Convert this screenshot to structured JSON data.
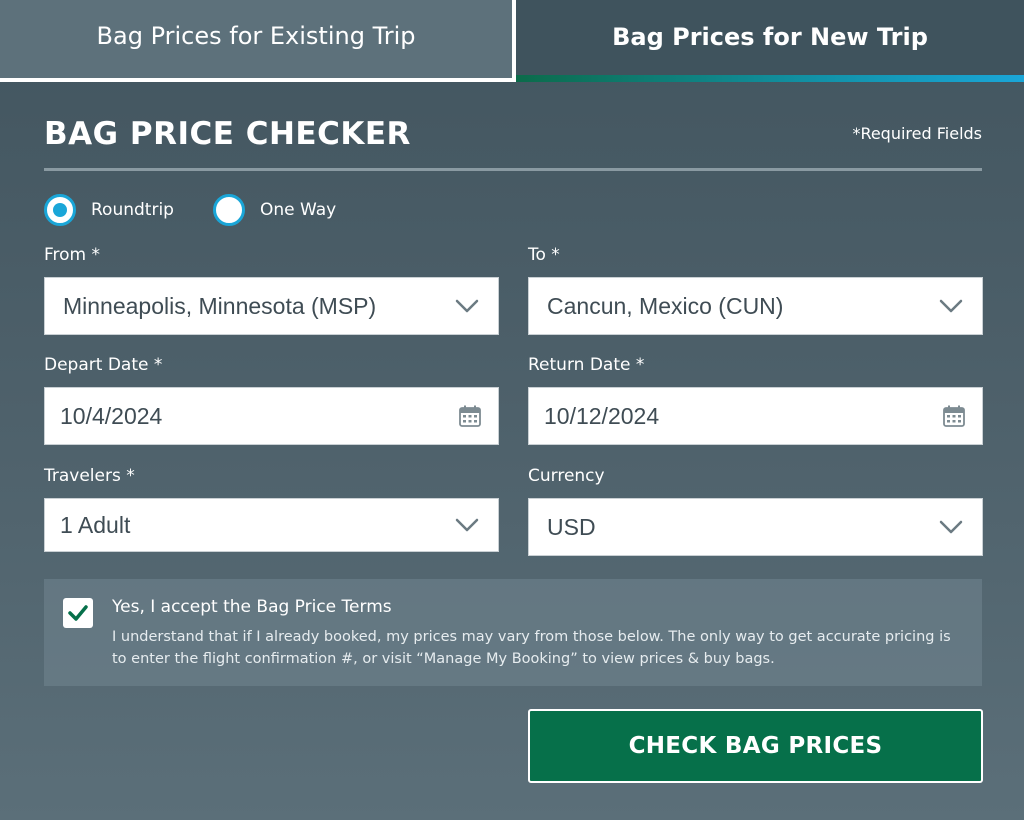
{
  "tabs": {
    "existing": "Bag Prices for Existing Trip",
    "new": "Bag Prices for New Trip",
    "active": "new"
  },
  "header": {
    "title": "BAG PRICE CHECKER",
    "required_note": "*Required Fields"
  },
  "trip_type": {
    "roundtrip": {
      "label": "Roundtrip",
      "selected": true
    },
    "one_way": {
      "label": "One Way",
      "selected": false
    }
  },
  "from": {
    "label": "From *",
    "value": "Minneapolis, Minnesota (MSP)"
  },
  "to": {
    "label": "To *",
    "value": "Cancun, Mexico (CUN)"
  },
  "depart": {
    "label": "Depart Date *",
    "value": "10/4/2024"
  },
  "return": {
    "label": "Return Date *",
    "value": "10/12/2024"
  },
  "travelers": {
    "label": "Travelers *",
    "value": "1 Adult"
  },
  "currency": {
    "label": "Currency",
    "value": "USD"
  },
  "terms": {
    "checked": true,
    "heading": "Yes, I accept the Bag Price Terms",
    "body": "I understand that if I already booked, my prices may vary from those below. The only way to get accurate pricing is to enter the flight confirmation #, or visit “Manage My Booking” to view prices & buy bags."
  },
  "submit": {
    "label": "CHECK BAG PRICES"
  },
  "icons": {
    "chevron": "chevron-down-icon",
    "calendar": "calendar-icon",
    "check": "checkmark-icon"
  },
  "colors": {
    "accent_blue": "#1aa6d8",
    "brand_green": "#06704a",
    "background": "#4f626c"
  }
}
